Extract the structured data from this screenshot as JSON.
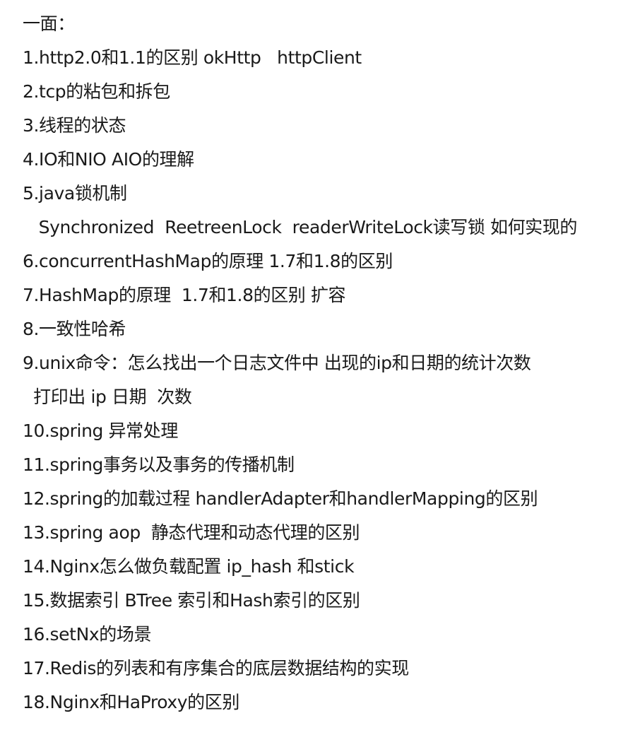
{
  "note": {
    "lines": [
      "一面：",
      "1.http2.0和1.1的区别 okHttp   httpClient",
      "2.tcp的粘包和拆包",
      "3.线程的状态",
      "4.IO和NIO AIO的理解",
      "5.java锁机制",
      "   Synchronized  ReetreenLock  readerWriteLock读写锁 如何实现的",
      "6.concurrentHashMap的原理 1.7和1.8的区别",
      "7.HashMap的原理  1.7和1.8的区别 扩容",
      "8.一致性哈希",
      "9.unix命令：怎么找出一个日志文件中 出现的ip和日期的统计次数",
      "  打印出 ip 日期  次数",
      "10.spring 异常处理",
      "11.spring事务以及事务的传播机制",
      "12.spring的加载过程 handlerAdapter和handlerMapping的区别",
      "13.spring aop  静态代理和动态代理的区别",
      "14.Nginx怎么做负载配置 ip_hash 和stick",
      "15.数据索引 BTree 索引和Hash索引的区别",
      "16.setNx的场景",
      "17.Redis的列表和有序集合的底层数据结构的实现",
      "18.Nginx和HaProxy的区别"
    ]
  }
}
